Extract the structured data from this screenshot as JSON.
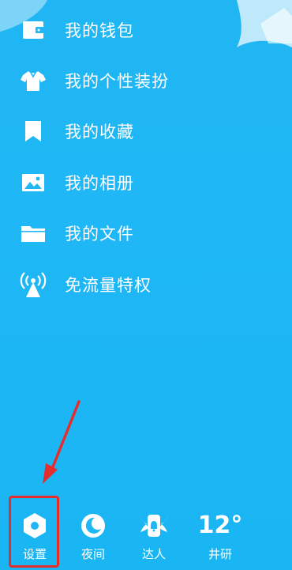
{
  "menu": {
    "items": [
      {
        "label": "我的钱包",
        "icon": "wallet-icon"
      },
      {
        "label": "我的个性装扮",
        "icon": "tshirt-icon"
      },
      {
        "label": "我的收藏",
        "icon": "bookmark-icon"
      },
      {
        "label": "我的相册",
        "icon": "photo-icon"
      },
      {
        "label": "我的文件",
        "icon": "folder-icon"
      },
      {
        "label": "免流量特权",
        "icon": "signal-tower-icon"
      }
    ]
  },
  "bottom_bar": {
    "settings_label": "设置",
    "night_label": "夜间",
    "expert_label": "达人",
    "weather_temp": "12°",
    "weather_location": "井研"
  },
  "colors": {
    "background": "#1fb7f5",
    "highlight": "#e52d2d",
    "text": "#ffffff"
  }
}
